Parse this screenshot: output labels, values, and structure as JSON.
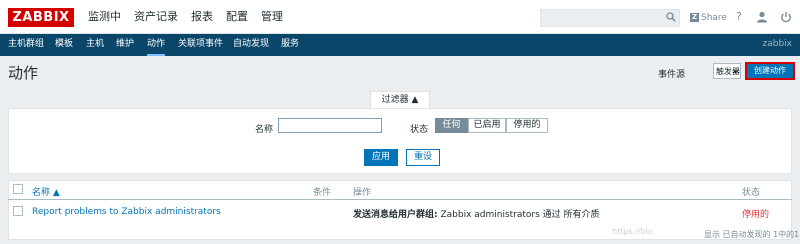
{
  "app": {
    "logo": "ZABBIX"
  },
  "main_menu": [
    "监测中",
    "资产记录",
    "报表",
    "配置",
    "管理"
  ],
  "header": {
    "share_label": "Share",
    "share_badge": "Z",
    "help": "?"
  },
  "sub_menu": {
    "items": [
      "主机群组",
      "模板",
      "主机",
      "维护",
      "动作",
      "关联项事件",
      "自动发现",
      "服务"
    ],
    "active": "动作",
    "corner": "zabbix"
  },
  "page": {
    "title": "动作",
    "source_label": "事件源",
    "source_value": "触发器",
    "create_button": "创建动作"
  },
  "filter": {
    "tab_label": "过滤器 ▲",
    "name_label": "名称",
    "name_value": "",
    "status_label": "状态",
    "status_options": [
      "任何",
      "已启用",
      "停用的"
    ],
    "status_selected": "任何",
    "apply": "应用",
    "reset": "重设"
  },
  "table": {
    "headers": {
      "name": "名称 ▲",
      "conditions": "条件",
      "operations": "操作",
      "status": "状态"
    },
    "rows": [
      {
        "name": "Report problems to Zabbix administrators",
        "conditions": "",
        "operation_bold": "发送消息给用户群组:",
        "operation_rest": " Zabbix administrators 通过 所有介质",
        "status": "停用的"
      }
    ],
    "footer": "显示 已自动发现的 1中的1"
  },
  "watermark": "https://blo",
  "colors": {
    "brand": "#d40000",
    "accent": "#0275b8",
    "nav": "#0a466a",
    "disabled": "#e33734"
  }
}
